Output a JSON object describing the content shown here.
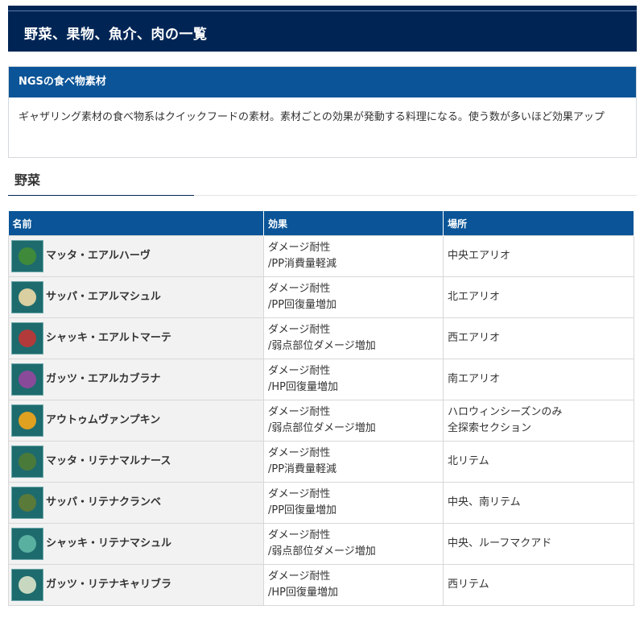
{
  "page_title": "野菜、果物、魚介、肉の一覧",
  "info_box": {
    "heading": "NGSの食べ物素材",
    "body": "ギャザリング素材の食べ物系はクイックフードの素材。素材ごとの効果が発動する料理になる。使う数が多いほど効果アップ"
  },
  "section_heading": "野菜",
  "table": {
    "headers": [
      "名前",
      "効果",
      "場所"
    ],
    "rows": [
      {
        "name": "マッタ・エアルハーヴ",
        "effect1": "ダメージ耐性",
        "effect2": "/PP消費量軽減",
        "loc1": "中央エアリオ",
        "loc2": "",
        "icon": "herb-icon",
        "color": "#3f8a3a"
      },
      {
        "name": "サッパ・エアルマシュル",
        "effect1": "ダメージ耐性",
        "effect2": "/PP回復量増加",
        "loc1": "北エアリオ",
        "loc2": "",
        "icon": "mushroom-icon",
        "color": "#d9cfa0"
      },
      {
        "name": "シャッキ・エアルトマーテ",
        "effect1": "ダメージ耐性",
        "effect2": "/弱点部位ダメージ増加",
        "loc1": "西エアリオ",
        "loc2": "",
        "icon": "tomato-icon",
        "color": "#b23a3a"
      },
      {
        "name": "ガッツ・エアルカブラナ",
        "effect1": "ダメージ耐性",
        "effect2": "/HP回復量増加",
        "loc1": "南エアリオ",
        "loc2": "",
        "icon": "turnip-icon",
        "color": "#8a4a9a"
      },
      {
        "name": "アウトゥムヴァンプキン",
        "effect1": "ダメージ耐性",
        "effect2": "/弱点部位ダメージ増加",
        "loc1": "ハロウィンシーズンのみ",
        "loc2": "全探索セクション",
        "icon": "pumpkin-icon",
        "color": "#e0a020"
      },
      {
        "name": "マッタ・リテナマルナース",
        "effect1": "ダメージ耐性",
        "effect2": "/PP消費量軽減",
        "loc1": "北リテム",
        "loc2": "",
        "icon": "grass-icon",
        "color": "#4a7a3a"
      },
      {
        "name": "サッパ・リテナクランベ",
        "effect1": "ダメージ耐性",
        "effect2": "/PP回復量増加",
        "loc1": "中央、南リテム",
        "loc2": "",
        "icon": "berry-icon",
        "color": "#5a7a3a"
      },
      {
        "name": "シャッキ・リテナマシュル",
        "effect1": "ダメージ耐性",
        "effect2": "/弱点部位ダメージ増加",
        "loc1": "中央、ルーフマクアド",
        "loc2": "",
        "icon": "mushroom-icon",
        "color": "#5ab0a0"
      },
      {
        "name": "ガッツ・リテナキャリブラ",
        "effect1": "ダメージ耐性",
        "effect2": "/HP回復量増加",
        "loc1": "西リテム",
        "loc2": "",
        "icon": "cauliflower-icon",
        "color": "#c8d8c0"
      }
    ]
  }
}
